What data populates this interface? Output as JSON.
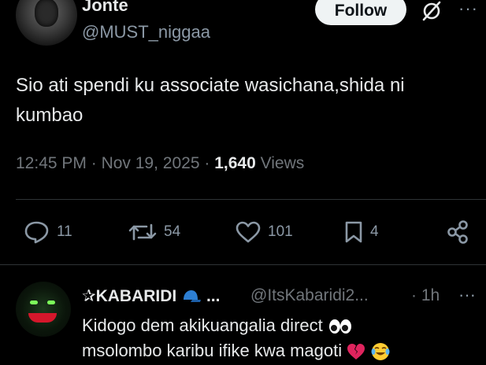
{
  "tweet": {
    "author_name": "Jonte",
    "author_handle": "@MUST_niggaa",
    "follow_label": "Follow",
    "more_label": "···",
    "text": "Sio ati spendi ku associate wasichana,shida ni kumbao",
    "time": "12:45 PM",
    "date": "Nov 19, 2025",
    "views_count": "1,640",
    "views_label": "Views",
    "separator": "·"
  },
  "actions": {
    "replies": "11",
    "reposts": "54",
    "likes": "101",
    "bookmarks": "4"
  },
  "reply": {
    "name": "✰KABARIDI",
    "name_suffix": "...",
    "handle": "@ItsKabaridi2...",
    "time": "· 1h",
    "more_label": "···",
    "text_line1": "Kidogo dem akikuangalia direct",
    "text_line2": "msolombo karibu ifike kwa magoti"
  },
  "icons": {
    "grok": "grok-icon",
    "reply": "reply-icon",
    "repost": "repost-icon",
    "like": "heart-icon",
    "bookmark": "bookmark-icon",
    "share": "share-icon",
    "cap": "blue-cap-emoji",
    "eyes": "eyes-emoji",
    "broken_heart": "broken-heart-emoji",
    "laugh": "tears-of-joy-emoji"
  },
  "colors": {
    "background": "#000000",
    "text": "#e7e9ea",
    "muted": "#71767b",
    "divider": "#2f3336",
    "follow_bg": "#eff3f4"
  }
}
